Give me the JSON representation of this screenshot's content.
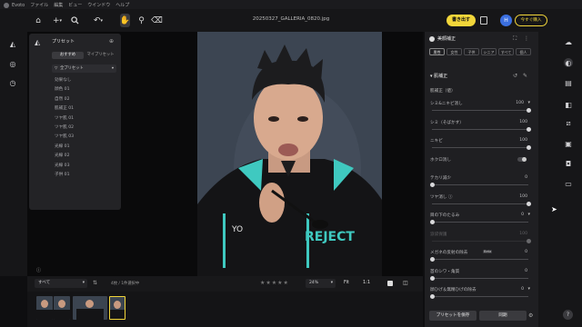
{
  "app": {
    "name": "Evoto",
    "file_title": "20250327_GALLERIA_0820.jpg"
  },
  "menu": [
    "ファイル",
    "編集",
    "ビュー",
    "ウインドウ",
    "ヘルプ"
  ],
  "toolbar": {
    "export_label": "書き出す",
    "avatar_letter": "H",
    "upgrade_label": "今すぐ購入"
  },
  "presets": {
    "title": "プリセット",
    "tabs": [
      "おすすめ",
      "マイプリセット"
    ],
    "filter": "全プリセット",
    "items": [
      "効果なし",
      "顔色 01",
      "自然 02",
      "肌補正 01",
      "ツヤ肌 01",
      "ツヤ肌 02",
      "ツヤ肌 03",
      "光線 01",
      "光線 02",
      "光線 03",
      "子供 01"
    ]
  },
  "bottombar": {
    "filter": "すべて",
    "count": "4枚 / 1件選択中",
    "zoom": "24%",
    "fit": "Fit",
    "ratio": "1:1"
  },
  "panel": {
    "title": "美顔補正",
    "tags": [
      "男性",
      "女性",
      "子供",
      "シニア",
      "すべて",
      "個人"
    ],
    "section": "肌補正",
    "subsection": "肌補正（値）",
    "sliders": [
      {
        "label": "シミ&ニキビ消し",
        "value": "100",
        "dropdown": true,
        "fill": 1.0
      },
      {
        "label": "シミ（そばかす）",
        "value": "100",
        "dropdown": false,
        "fill": 1.0
      },
      {
        "label": "ニキビ",
        "value": "100",
        "dropdown": false,
        "fill": 1.0
      },
      {
        "label": "ホクロ消し",
        "value": "",
        "dropdown": false,
        "toggle": true,
        "fill": 0.0
      },
      {
        "label": "テカリ減少",
        "value": "0",
        "dropdown": false,
        "fill": 0.0
      },
      {
        "label": "ツヤ消し ⓘ",
        "value": "100",
        "dropdown": false,
        "fill": 1.0
      },
      {
        "label": "目の下のたるみ",
        "value": "0",
        "dropdown": true,
        "fill": 0.0
      },
      {
        "label": "涙袋保護",
        "value": "100",
        "dropdown": false,
        "fill": 1.0,
        "disabled": true
      },
      {
        "label": "メガネの反射の除去",
        "value": "0",
        "dropdown": false,
        "fill": 0.0,
        "badge": "Beta"
      },
      {
        "label": "首のシワ・角質",
        "value": "0",
        "dropdown": false,
        "fill": 0.0
      },
      {
        "label": "顔ひげ＆無精ひげの除去",
        "value": "0",
        "dropdown": true,
        "fill": 0.0
      }
    ],
    "save_label": "プリセットを保存",
    "sync_label": "同期"
  },
  "colors": {
    "accent": "#f2d63a",
    "panel": "#1f1f22",
    "photo_bg": "#3c4552",
    "teal": "#3fc9c0"
  }
}
